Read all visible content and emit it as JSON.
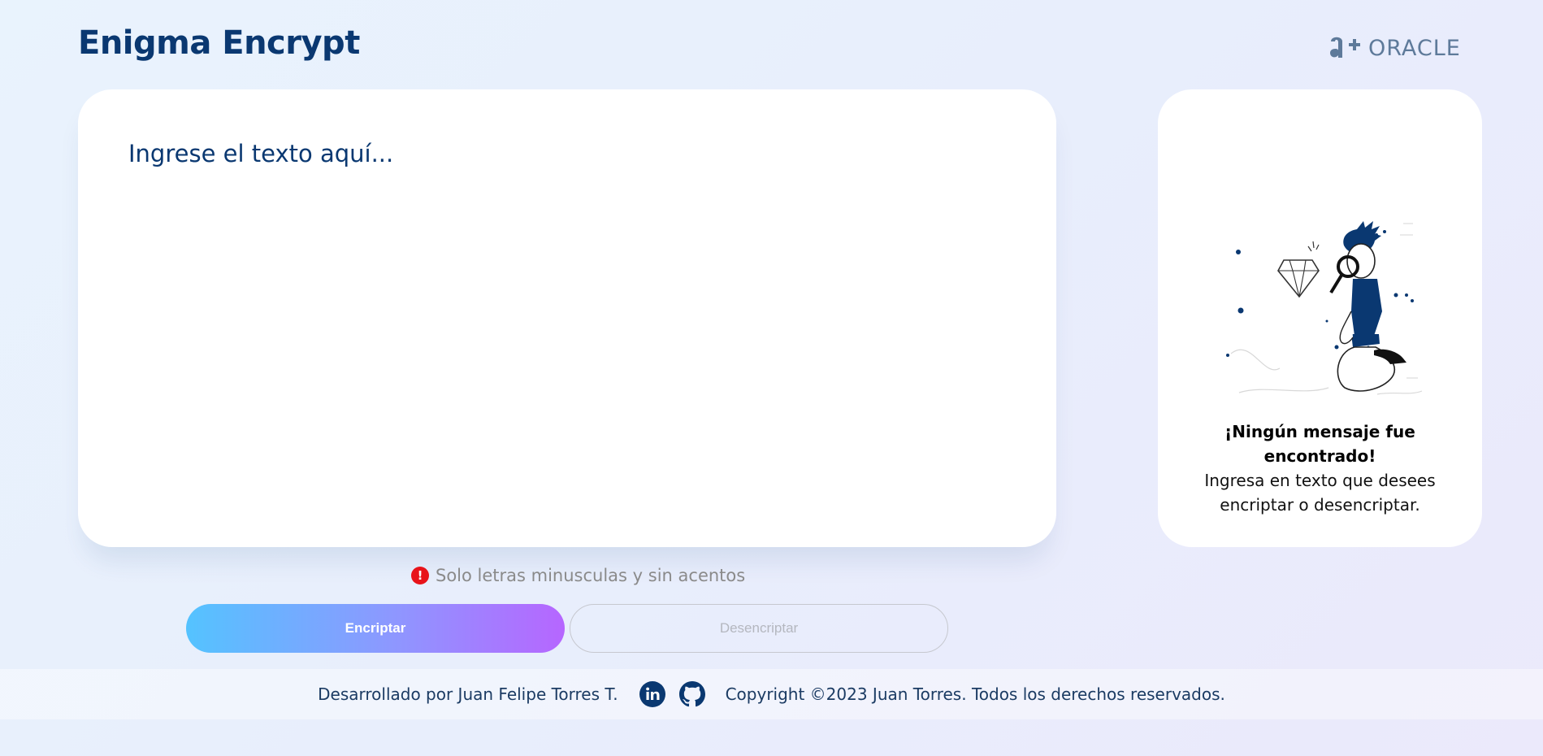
{
  "header": {
    "title": "Enigma Encrypt",
    "logo_text": "ORACLE",
    "logo_mark_icon": "alura-oracle-logo-icon"
  },
  "input": {
    "placeholder": "Ingrese el texto aquí...",
    "value": ""
  },
  "output": {
    "illustration_icon": "person-with-magnifier-illustration",
    "title": "¡Ningún mensaje fue encontrado!",
    "description": "Ingresa en texto que desees encriptar o desencriptar."
  },
  "warning": {
    "icon": "exclamation-circle-icon",
    "text": "Solo letras minusculas y sin acentos"
  },
  "buttons": {
    "encrypt_label": "Encriptar",
    "decrypt_label": "Desencriptar"
  },
  "footer": {
    "credit": "Desarrollado por Juan Felipe Torres T.",
    "social": [
      {
        "icon": "linkedin-icon"
      },
      {
        "icon": "github-icon"
      }
    ],
    "copyright": "Copyright ©2023 Juan Torres. Todos los derechos reservados."
  },
  "colors": {
    "primary": "#0a3871",
    "accent_gradient_start": "#54c3ff",
    "accent_gradient_end": "#b666ff",
    "warning": "#e8131a"
  }
}
